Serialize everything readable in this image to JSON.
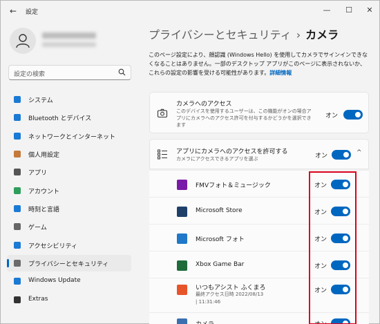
{
  "window": {
    "title": "設定",
    "back_glyph": "←",
    "minimize_glyph": "—",
    "maximize_glyph": "☐",
    "close_glyph": "✕"
  },
  "search": {
    "placeholder": "設定の検索",
    "icon": "search-icon"
  },
  "sidebar": {
    "items": [
      {
        "label": "システム",
        "icon": "system-icon",
        "color": "#1a7ad4"
      },
      {
        "label": "Bluetooth とデバイス",
        "icon": "bluetooth-icon",
        "color": "#1a7ad4"
      },
      {
        "label": "ネットワークとインターネット",
        "icon": "wifi-icon",
        "color": "#1a7ad4"
      },
      {
        "label": "個人用設定",
        "icon": "personalization-icon",
        "color": "#c47a3a"
      },
      {
        "label": "アプリ",
        "icon": "apps-icon",
        "color": "#555555"
      },
      {
        "label": "アカウント",
        "icon": "account-icon",
        "color": "#2e9e5b"
      },
      {
        "label": "時刻と言語",
        "icon": "time-language-icon",
        "color": "#1a7ad4"
      },
      {
        "label": "ゲーム",
        "icon": "gaming-icon",
        "color": "#666666"
      },
      {
        "label": "アクセシビリティ",
        "icon": "accessibility-icon",
        "color": "#1a7ad4"
      },
      {
        "label": "プライバシーとセキュリティ",
        "icon": "shield-icon",
        "color": "#6b6b6b",
        "active": true
      },
      {
        "label": "Windows Update",
        "icon": "update-icon",
        "color": "#1a7ad4"
      },
      {
        "label": "Extras",
        "icon": "extras-icon",
        "color": "#333333"
      }
    ]
  },
  "breadcrumb": {
    "parent": "プライバシーとセキュリティ",
    "separator": "›",
    "current": "カメラ"
  },
  "description": {
    "text": "このページ設定により、顔認識 (Windows Hello) を使用してカメラでサインインできなくなることはありません。一部のデスクトップ アプリがこのページに表示されないか、これらの設定の影響を受ける可能性があります。",
    "link": "詳細情報"
  },
  "camera_access": {
    "title": "カメラへのアクセス",
    "subtitle": "このデバイスを使用するユーザーは、この機能がオンの場合アプリにカメラへのアクセス許可を付与するかどうかを選択できます",
    "state": "オン",
    "on": true
  },
  "app_access": {
    "title": "アプリにカメラへのアクセスを許可する",
    "subtitle": "カメラにアクセスできるアプリを選ぶ",
    "state": "オン",
    "on": true,
    "chevron": "^"
  },
  "apps": [
    {
      "name": "FMVフォト＆ミュージック",
      "state": "オン",
      "on": true,
      "color": "#7a1aa8"
    },
    {
      "name": "Microsoft Store",
      "state": "オン",
      "on": true,
      "color": "#1f3f6b"
    },
    {
      "name": "Microsoft フォト",
      "state": "オン",
      "on": true,
      "color": "#1f78c8"
    },
    {
      "name": "Xbox Game Bar",
      "state": "オン",
      "on": true,
      "color": "#1f6b3a"
    },
    {
      "name": "いつもアシスト ふくまろ",
      "sub1": "最終アクセス日時 2022/08/13",
      "sub2": "| 11:31:46",
      "state": "オン",
      "on": true,
      "color": "#e8542a"
    },
    {
      "name": "カメラ",
      "state": "オン",
      "on": true,
      "color": "#3a6fb0"
    }
  ]
}
